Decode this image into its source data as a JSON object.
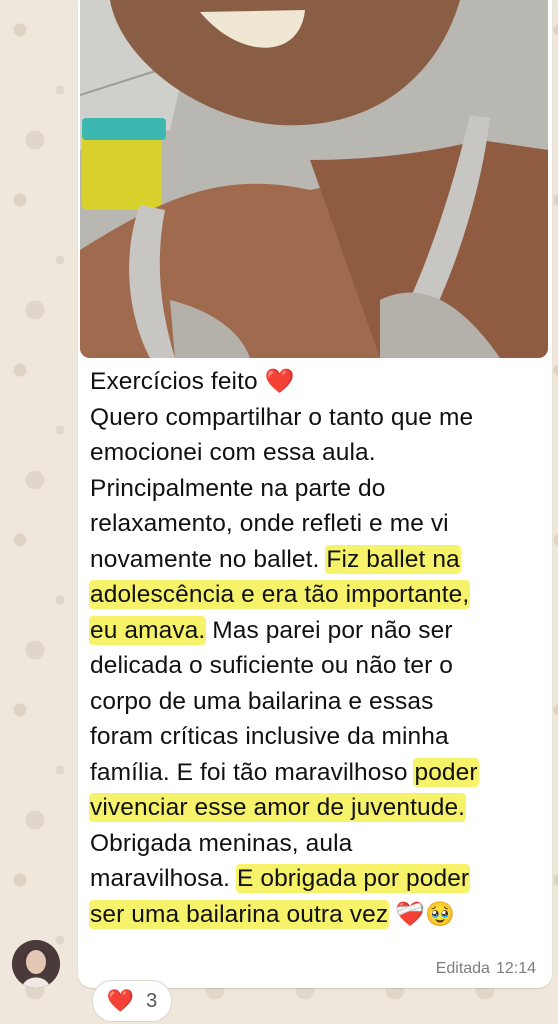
{
  "message": {
    "lines": [
      {
        "text": "Exercícios feito ",
        "emoji": "❤️"
      },
      {
        "text": "Quero compartilhar o tanto que me"
      },
      {
        "text": "emocionei com essa aula."
      },
      {
        "text": "Principalmente na parte do"
      },
      {
        "text": "relaxamento, onde refleti e me vi"
      }
    ],
    "line6_plain": "novamente no ballet. ",
    "line6_hl": "Fiz ballet na",
    "line7_hl": "adolescência e era tão importante,",
    "line8_hl": "eu amava.",
    "line8_plain": " Mas parei por não ser",
    "line9": "delicada o suficiente ou não ter o",
    "line10": "corpo de uma bailarina e essas",
    "line11": "foram críticas inclusive da minha",
    "line12_plain": "família. E foi tão maravilhoso ",
    "line12_hl": "poder",
    "line13_hl": "vivenciar esse amor de juventude.",
    "line14": "Obrigada meninas, aula",
    "line15_plain": "maravilhosa. ",
    "line15_hl": "E obrigada por poder",
    "line16_hl": "ser uma bailarina outra vez",
    "line16_emojis": "❤️‍🩹🥹"
  },
  "meta": {
    "status": "Editada",
    "time": "12:14"
  },
  "reaction": {
    "emoji": "❤️",
    "count": "3"
  },
  "icons": {
    "reaction_icon": "heart-icon",
    "avatar": "sender-avatar"
  },
  "colors": {
    "highlight": "#f6f36a",
    "bubble": "#ffffff",
    "wallpaper": "#efe7dc"
  }
}
